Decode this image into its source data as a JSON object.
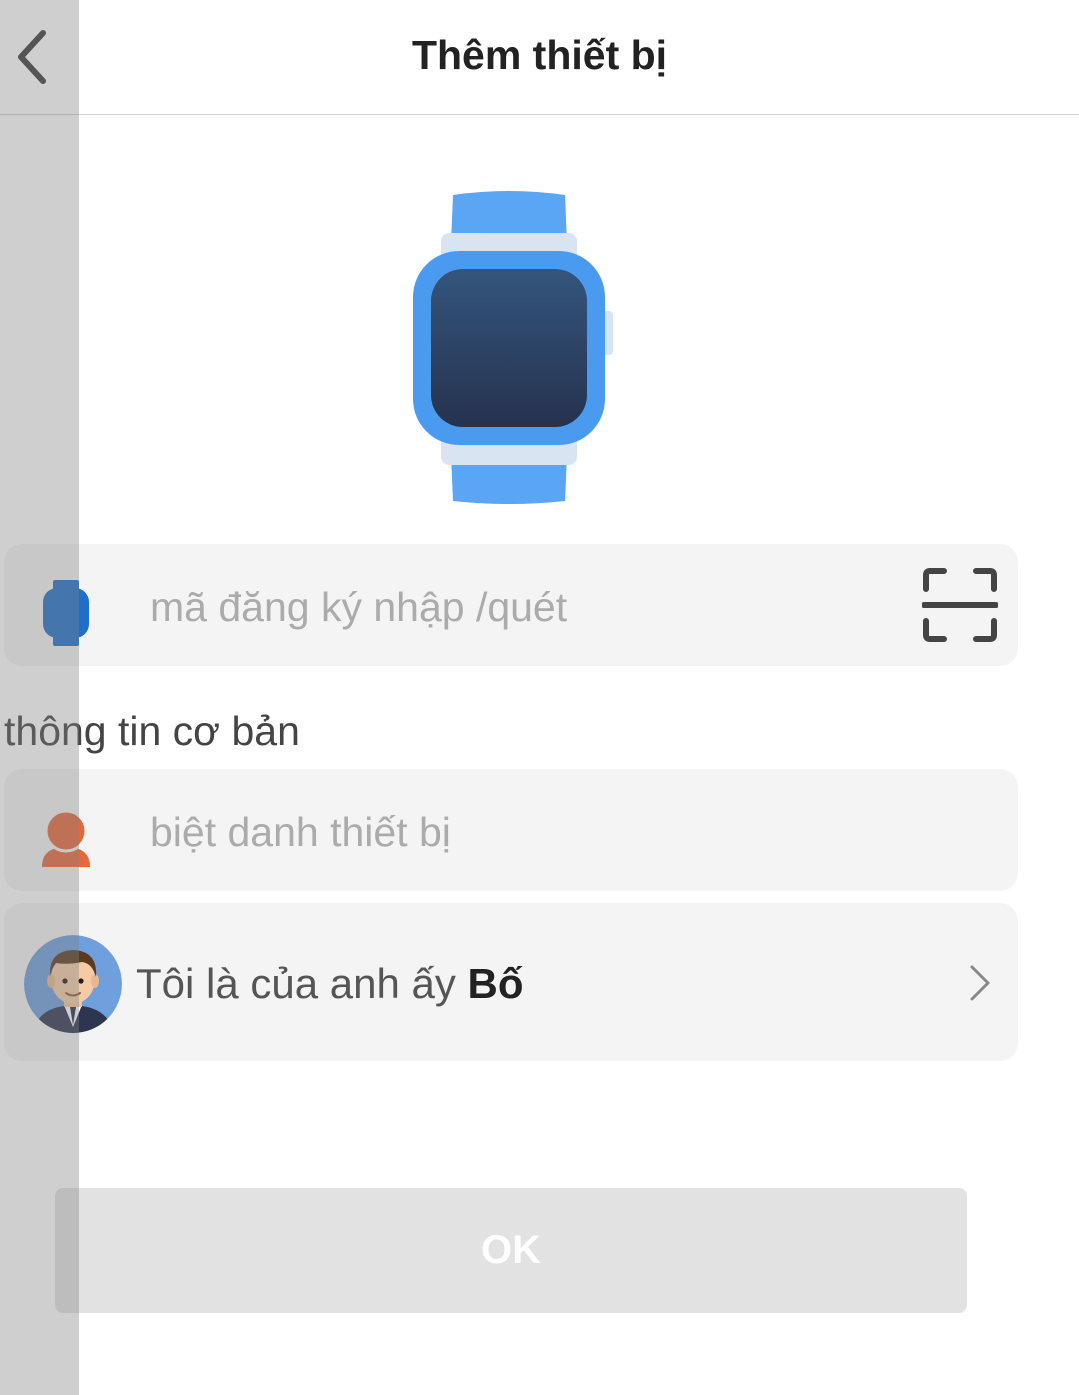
{
  "header": {
    "title": "Thêm thiết bị",
    "back_icon": "chevron-left-icon"
  },
  "code_field": {
    "placeholder": "mã đăng ký nhập /quét",
    "icon": "watch-icon",
    "scan_icon": "scan-icon"
  },
  "section": {
    "label": "thông tin cơ bản"
  },
  "nickname_field": {
    "placeholder": "biệt danh thiết bị",
    "icon": "person-icon"
  },
  "relation": {
    "prefix": "Tôi là của anh ấy ",
    "value": "Bố",
    "avatar_icon": "father-avatar-icon",
    "chevron_icon": "chevron-right-icon"
  },
  "ok_button": {
    "label": "OK"
  },
  "colors": {
    "accent_blue": "#4a9bf0",
    "field_bg": "#f4f4f4",
    "button_disabled": "#e2e2e2",
    "person_orange": "#e5683a"
  }
}
